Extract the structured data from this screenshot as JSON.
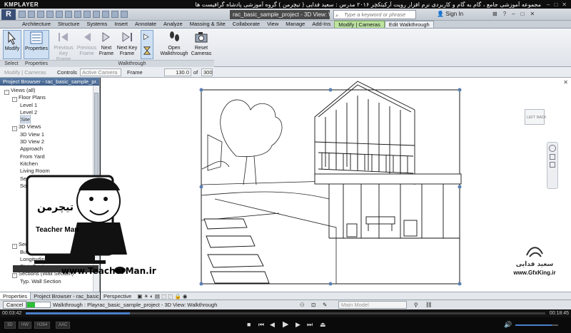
{
  "player": {
    "logo": "KMPLAYER",
    "title": "مجموعه آموزشی جامع ، گام به گام و کاربردی نرم افزار رویت آرکیتکچر ۲۰۱۶   مدرس : سعید فدایی ( تیچرمن ) گروه آموزشی پادشاه گرافیست ها",
    "time_current": "00:03:42",
    "time_total": "00:18:45",
    "progress": 0.2,
    "volume": 0.85,
    "chips": [
      "3D",
      "HW",
      "H264",
      "AAC"
    ]
  },
  "revit": {
    "app_button": "R",
    "doc_title": "rac_basic_sample_project - 3D View: Walkthrough 1",
    "search_placeholder": "Type a keyword or phrase",
    "sign_in": "Sign In"
  },
  "ribbon_tabs": [
    {
      "label": "Architecture",
      "state": "normal"
    },
    {
      "label": "Structure",
      "state": "normal"
    },
    {
      "label": "Systems",
      "state": "normal"
    },
    {
      "label": "Insert",
      "state": "normal"
    },
    {
      "label": "Annotate",
      "state": "normal"
    },
    {
      "label": "Analyze",
      "state": "normal"
    },
    {
      "label": "Massing & Site",
      "state": "normal"
    },
    {
      "label": "Collaborate",
      "state": "normal"
    },
    {
      "label": "View",
      "state": "normal"
    },
    {
      "label": "Manage",
      "state": "normal"
    },
    {
      "label": "Add-Ins",
      "state": "normal"
    },
    {
      "label": "Modify | Cameras",
      "state": "ctx"
    },
    {
      "label": "Edit Walkthrough",
      "state": "active"
    }
  ],
  "ribbon": {
    "modify": "Modify",
    "properties": "Properties",
    "prev_key_frame": "Previous Key Frame",
    "prev_frame": "Previous Frame",
    "next_frame": "Next Frame",
    "next_key_frame": "Next Key Frame",
    "play": "",
    "open_walkthrough": "Open Walkthrough",
    "reset_cameras": "Reset Cameras",
    "group_select": "Select",
    "group_properties": "Properties",
    "group_walkthrough": "Walkthrough"
  },
  "optbar": {
    "context": "Modify | Cameras",
    "controls_label": "Controls",
    "controls_value": "Active Camera",
    "frame_label": "Frame",
    "frame_value": "130.0",
    "of_label": "of",
    "total_frames": "300"
  },
  "browser": {
    "title": "Project Browser - rac_basic_sample_pr...",
    "nodes": [
      {
        "label": "Views (all)",
        "level": 0,
        "exp": "-"
      },
      {
        "label": "Floor Plans",
        "level": 1,
        "exp": "-"
      },
      {
        "label": "Level 1",
        "level": 2,
        "exp": ""
      },
      {
        "label": "Level 2",
        "level": 2,
        "exp": ""
      },
      {
        "label": "Site",
        "level": 2,
        "exp": "",
        "sel": true
      },
      {
        "label": "3D Views",
        "level": 1,
        "exp": "-"
      },
      {
        "label": "3D View 1",
        "level": 2,
        "exp": ""
      },
      {
        "label": "3D View 2",
        "level": 2,
        "exp": ""
      },
      {
        "label": "Approach",
        "level": 2,
        "exp": ""
      },
      {
        "label": "From Yard",
        "level": 2,
        "exp": ""
      },
      {
        "label": "Kitchen",
        "level": 2,
        "exp": ""
      },
      {
        "label": "Living Room",
        "level": 2,
        "exp": ""
      },
      {
        "label": "Section Perspective",
        "level": 2,
        "exp": ""
      },
      {
        "label": "Solar Analysis",
        "level": 2,
        "exp": ""
      },
      {
        "label": "",
        "level": 1,
        "exp": ""
      },
      {
        "label": "",
        "level": 1,
        "exp": ""
      },
      {
        "label": "",
        "level": 1,
        "exp": ""
      },
      {
        "label": "",
        "level": 1,
        "exp": ""
      },
      {
        "label": "",
        "level": 1,
        "exp": ""
      },
      {
        "label": "",
        "level": 1,
        "exp": ""
      },
      {
        "label": "",
        "level": 1,
        "exp": ""
      },
      {
        "label": "Sections (Building Se...",
        "level": 1,
        "exp": "-"
      },
      {
        "label": "Building Section",
        "level": 2,
        "exp": ""
      },
      {
        "label": "Longitudinal Section",
        "level": 2,
        "exp": ""
      },
      {
        "label": "Stair Section",
        "level": 2,
        "exp": ""
      },
      {
        "label": "Sections (Wall Section)",
        "level": 1,
        "exp": "-"
      },
      {
        "label": "Typ. Wall Section",
        "level": 2,
        "exp": ""
      }
    ]
  },
  "bottom_tabs": [
    "Properties",
    "Project Browser - rac_basic_sa..."
  ],
  "view_control": {
    "label": "Perspective"
  },
  "status": {
    "cancel": "Cancel",
    "text": "Walkthrough : Playrac_basic_sample_project - 3D View: Walkthrough 1",
    "progress": 0.35,
    "model": "Main Model"
  },
  "viewcube": {
    "left": "LEFT",
    "back": "BACK"
  },
  "watermarks": {
    "teacher_url": "www.TeacherMan.ir",
    "teacher_brand": "Teacher Man",
    "teacher_logo": "تیچرمن",
    "gfx_name": "سعید فدایی",
    "gfx_url": "www.GfxKing.ir"
  }
}
